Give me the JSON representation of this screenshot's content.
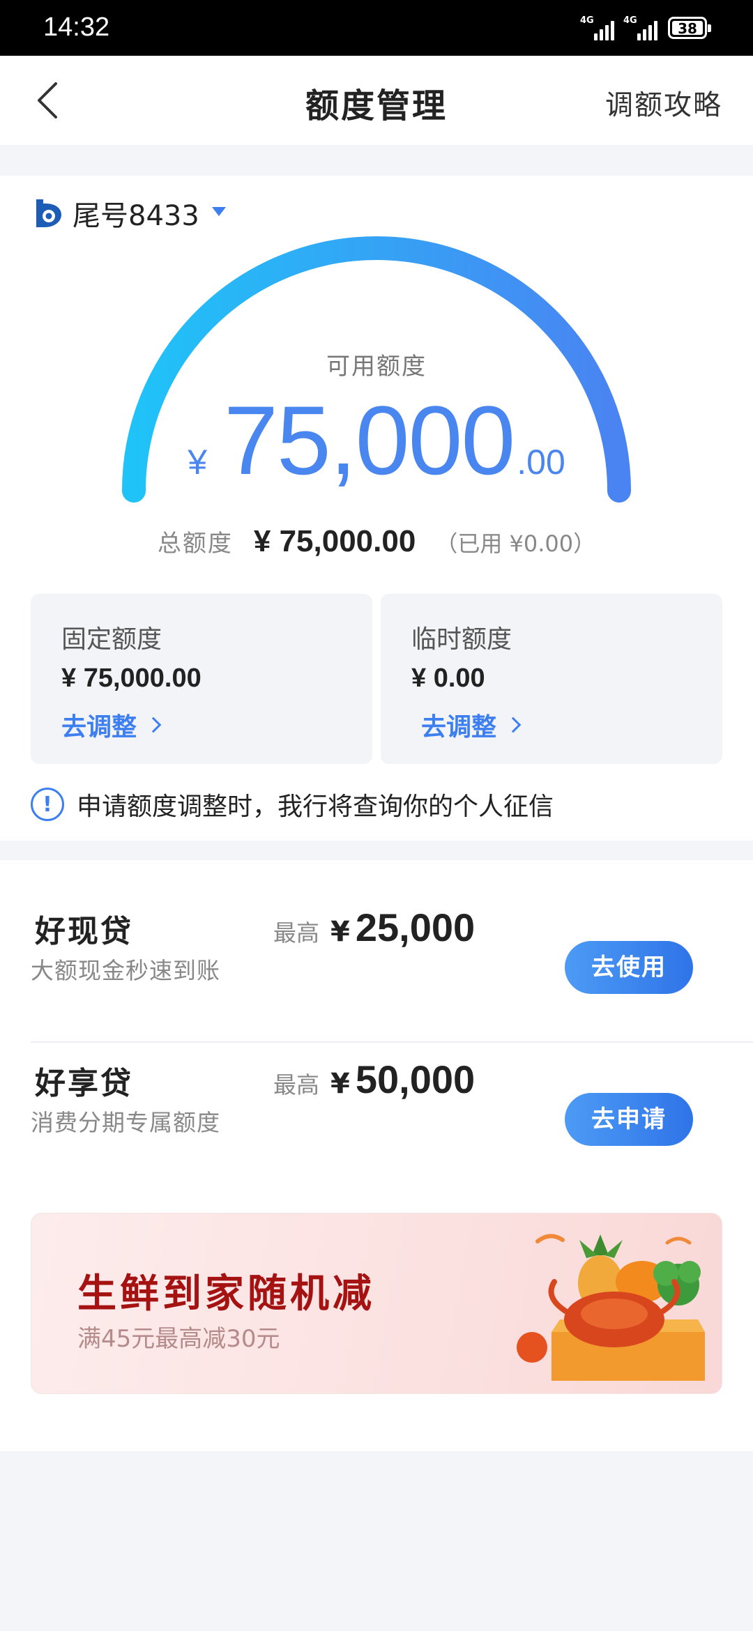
{
  "status_bar": {
    "time": "14:32",
    "network1": "4G",
    "network2": "4G",
    "battery": "38"
  },
  "header": {
    "title": "额度管理",
    "right_link": "调额攻略",
    "back_icon": "chevron-left-icon"
  },
  "card": {
    "label": "尾号8433"
  },
  "quota": {
    "available_label": "可用额度",
    "currency": "¥",
    "available_int": "75,000",
    "available_dec": ".00",
    "total_label": "总额度",
    "total_value": "¥ 75,000.00",
    "used_text": "（已用 ¥0.00）",
    "gauge_fraction": 1.0,
    "gauge_color_start": "#1fc3f8",
    "gauge_color_end": "#4a83f2"
  },
  "limits": [
    {
      "label": "固定额度",
      "value": "¥ 75,000.00",
      "link": "去调整"
    },
    {
      "label": "临时额度",
      "value": "¥ 0.00",
      "link": "去调整"
    }
  ],
  "notice": {
    "icon": "info-icon",
    "text": "申请额度调整时，我行将查询你的个人征信"
  },
  "loans": [
    {
      "name": "好现贷",
      "desc": "大额现金秒速到账",
      "max_label": "最高",
      "currency": "¥",
      "max_value": "25,000",
      "button": "去使用"
    },
    {
      "name": "好享贷",
      "desc": "消费分期专属额度",
      "max_label": "最高",
      "currency": "¥",
      "max_value": "50,000",
      "button": "去申请"
    }
  ],
  "banner": {
    "title": "生鲜到家随机减",
    "subtitle": "满45元最高减30元"
  },
  "colors": {
    "accent": "#3d7ff0",
    "amount": "#4a86f0",
    "banner_title": "#a51212"
  }
}
